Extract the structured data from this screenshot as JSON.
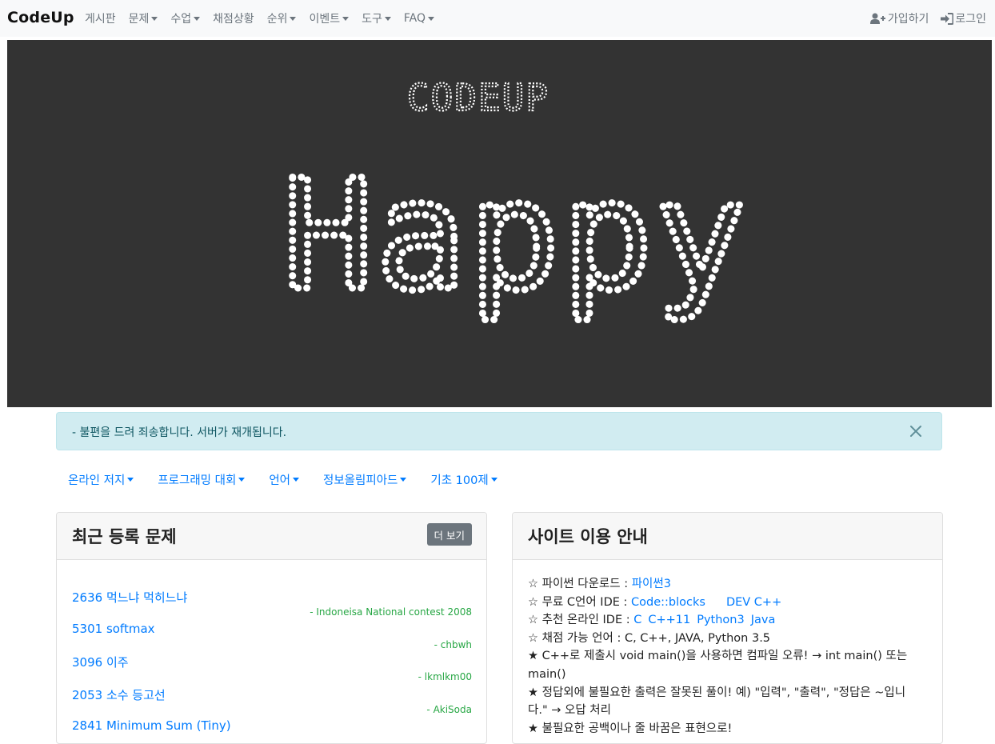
{
  "navbar": {
    "brand": "CodeUp",
    "items": [
      {
        "label": "게시판",
        "dropdown": false
      },
      {
        "label": "문제",
        "dropdown": true
      },
      {
        "label": "수업",
        "dropdown": true
      },
      {
        "label": "채점상황",
        "dropdown": false
      },
      {
        "label": "순위",
        "dropdown": true
      },
      {
        "label": "이벤트",
        "dropdown": true
      },
      {
        "label": "도구",
        "dropdown": true
      },
      {
        "label": "FAQ",
        "dropdown": true
      }
    ],
    "signup_label": "가입하기",
    "login_label": "로그인"
  },
  "banner": {
    "top_text": "CODEUP",
    "main_text": "Happy",
    "background": "#333333"
  },
  "alert": {
    "message": "- 불편을 드려 죄송합니다. 서버가 재개됩니다."
  },
  "categories": [
    "온라인 저지",
    "프로그래밍 대회",
    "언어",
    "정보올림피아드",
    "기초 100제"
  ],
  "recent_problems": {
    "title": "최근 등록 문제",
    "more_label": "더 보기",
    "items": [
      {
        "title": "2636 먹느냐 먹히느냐",
        "source": "- Indoneisa National contest 2008"
      },
      {
        "title": "5301 softmax",
        "source": "- chbwh"
      },
      {
        "title": "3096 이주",
        "source": "- lkmlkm00"
      },
      {
        "title": "2053 소수 등고선",
        "source": "- AkiSoda"
      },
      {
        "title": "2841 Minimum Sum (Tiny)",
        "source": ""
      }
    ]
  },
  "site_guide": {
    "title": "사이트 이용 안내",
    "python_prefix": "☆ 파이썬 다운로드 : ",
    "python_link": "파이썬3",
    "ide_prefix": "☆ 무료 C언어 IDE : ",
    "ide_links": [
      "Code::blocks",
      "DEV C++"
    ],
    "online_prefix": "☆ 추천 온라인 IDE : ",
    "online_links": [
      "C",
      "C++11",
      "Python3",
      "Java"
    ],
    "languages_line": "☆ 채점 가능 언어 : C, C++, JAVA, Python 3.5",
    "note_cpp": "★ C++로 제출시 void main()을 사용하면 컴파일 오류! → int main() 또는 main()",
    "note_output": "★ 정답외에 불필요한 출력은 잘못된 풀이!  예) \"입력\", \"출력\", \"정답은 ~입니다.\" → 오답 처리",
    "note_partial": "★ 불필요한 공백이나 줄 바꿈은 표현으로!"
  },
  "colors": {
    "link": "#007bff",
    "source_green": "#28a745",
    "alert_bg": "#d1ecf1",
    "alert_text": "#0c5460",
    "navbar_bg": "#f8f9fa"
  }
}
